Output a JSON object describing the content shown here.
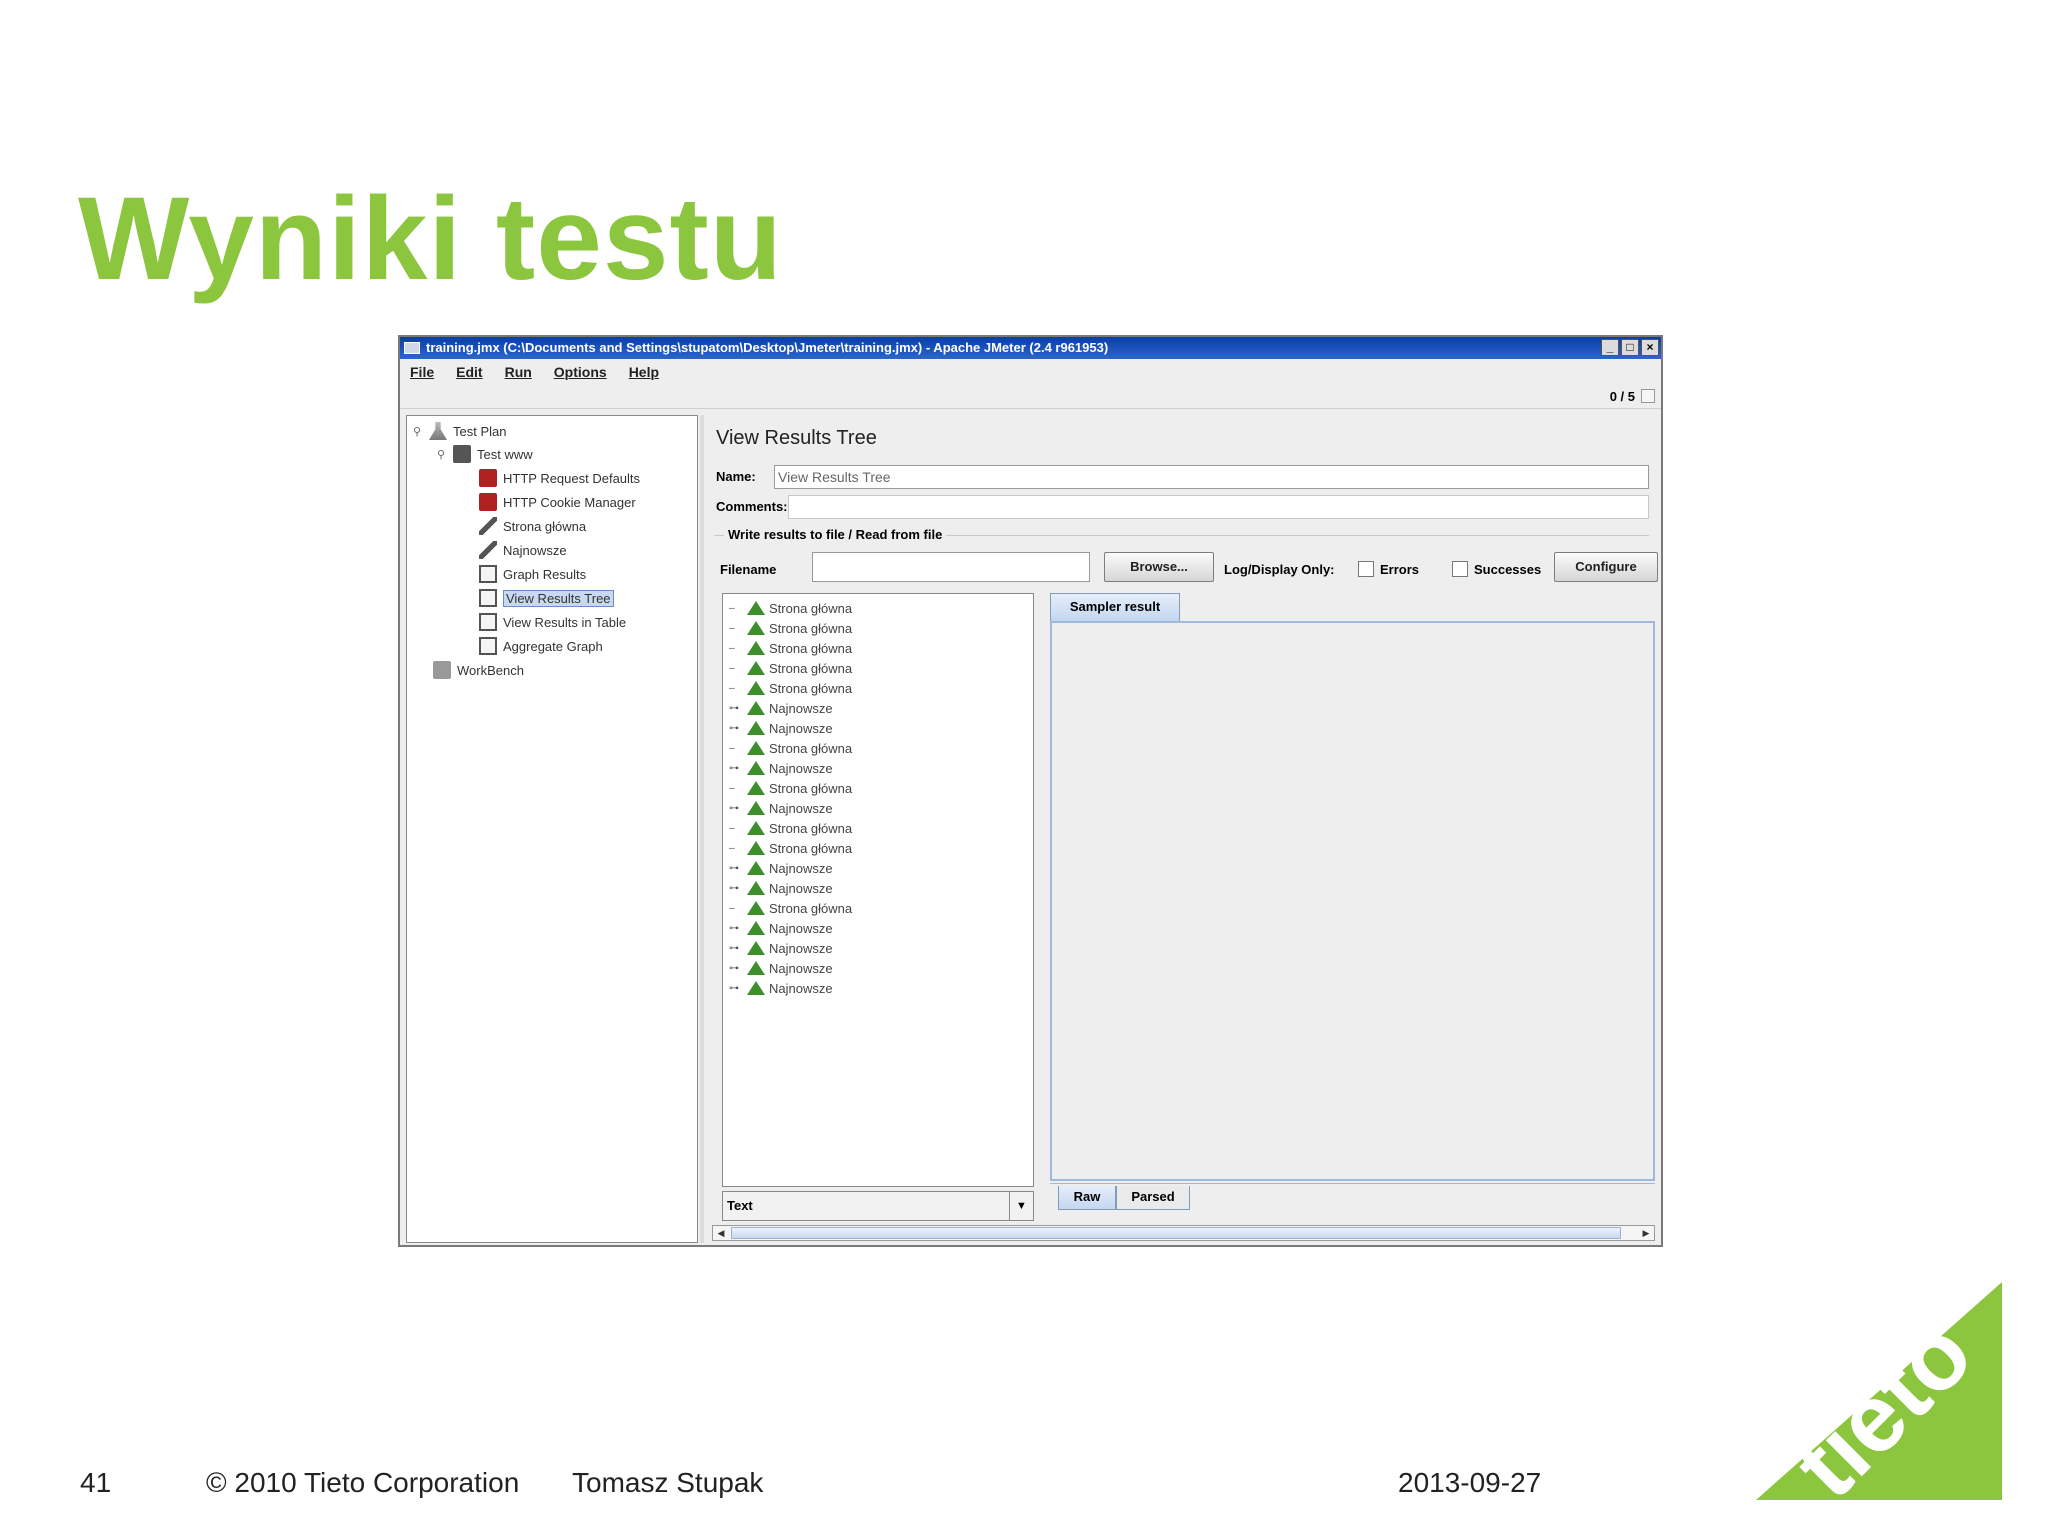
{
  "slide": {
    "title": "Wyniki testu",
    "footer": {
      "page_number": "41",
      "copyright": "© 2010 Tieto Corporation",
      "author": "Tomasz Stupak",
      "date": "2013-09-27"
    },
    "logo_text": "tieto",
    "brand_color": "#8cc63f"
  },
  "window": {
    "title": "training.jmx (C:\\Documents and Settings\\stupatom\\Desktop\\Jmeter\\training.jmx) - Apache JMeter (2.4 r961953)",
    "controls": [
      "_",
      "□",
      "×"
    ],
    "menu": [
      "File",
      "Edit",
      "Run",
      "Options",
      "Help"
    ],
    "status_counter": "0 / 5"
  },
  "tree": [
    {
      "label": "Test Plan",
      "icon": "flask-icon",
      "expander": "⚲"
    },
    {
      "label": "Test www",
      "icon": "thread-group-icon",
      "expander": "⚲"
    },
    {
      "label": "HTTP Request Defaults",
      "icon": "config-icon"
    },
    {
      "label": "HTTP Cookie Manager",
      "icon": "config-icon"
    },
    {
      "label": "Strona główna",
      "icon": "sampler-icon"
    },
    {
      "label": "Najnowsze",
      "icon": "sampler-icon"
    },
    {
      "label": "Graph Results",
      "icon": "listener-icon"
    },
    {
      "label": "View Results Tree",
      "icon": "listener-icon",
      "selected": true
    },
    {
      "label": "View Results in Table",
      "icon": "listener-icon"
    },
    {
      "label": "Aggregate Graph",
      "icon": "listener-icon"
    },
    {
      "label": "WorkBench",
      "icon": "workbench-icon"
    }
  ],
  "panel": {
    "heading": "View Results Tree",
    "name_label": "Name:",
    "name_value": "View Results Tree",
    "comments_label": "Comments:",
    "group_title": "Write results to file / Read from file",
    "filename_label": "Filename",
    "browse_label": "Browse...",
    "log_display_label": "Log/Display Only:",
    "errors_label": "Errors",
    "successes_label": "Successes",
    "configure_label": "Configure",
    "render_select": "Text",
    "sampler_tab": "Sampler result",
    "bottom_tabs": [
      "Raw",
      "Parsed"
    ]
  },
  "results": [
    {
      "label": "Strona główna",
      "expandable": false
    },
    {
      "label": "Strona główna",
      "expandable": false
    },
    {
      "label": "Strona główna",
      "expandable": false
    },
    {
      "label": "Strona główna",
      "expandable": false
    },
    {
      "label": "Strona główna",
      "expandable": false
    },
    {
      "label": "Najnowsze",
      "expandable": true
    },
    {
      "label": "Najnowsze",
      "expandable": true
    },
    {
      "label": "Strona główna",
      "expandable": false
    },
    {
      "label": "Najnowsze",
      "expandable": true
    },
    {
      "label": "Strona główna",
      "expandable": false
    },
    {
      "label": "Najnowsze",
      "expandable": true
    },
    {
      "label": "Strona główna",
      "expandable": false
    },
    {
      "label": "Strona główna",
      "expandable": false
    },
    {
      "label": "Najnowsze",
      "expandable": true
    },
    {
      "label": "Najnowsze",
      "expandable": true
    },
    {
      "label": "Strona główna",
      "expandable": false
    },
    {
      "label": "Najnowsze",
      "expandable": true
    },
    {
      "label": "Najnowsze",
      "expandable": true
    },
    {
      "label": "Najnowsze",
      "expandable": true
    },
    {
      "label": "Najnowsze",
      "expandable": true
    }
  ]
}
